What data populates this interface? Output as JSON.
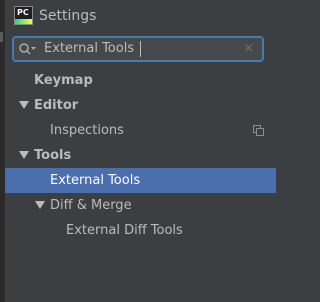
{
  "window": {
    "title": "Settings",
    "logo_text": "PC"
  },
  "search": {
    "value": "External Tools",
    "icon": "search-with-dropdown-icon",
    "clear_icon": "×"
  },
  "tree": {
    "keymap": "Keymap",
    "editor": "Editor",
    "inspections": "Inspections",
    "tools": "Tools",
    "external_tools": "External Tools",
    "diff_merge": "Diff & Merge",
    "external_diff_tools": "External Diff Tools"
  },
  "colors": {
    "background": "#3c3f41",
    "selection": "#4b6eaf",
    "focus_border": "#467ab3",
    "text": "#bbbbbb"
  }
}
